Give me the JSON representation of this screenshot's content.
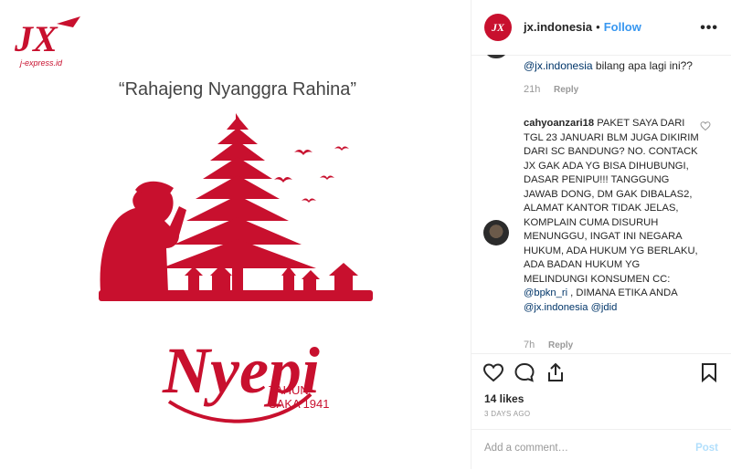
{
  "image": {
    "logo_text": "JX",
    "logo_tagline": "j-express.id",
    "greeting": "“Rahajeng Nyanggra Rahina”",
    "title": "Nyepi",
    "tahun": "TAHUN",
    "saka": "SAKA 1941",
    "brand_color": "#c8102e"
  },
  "header": {
    "avatar_text": "JX",
    "username": "jx.indonesia",
    "dot": "•",
    "follow": "Follow",
    "more": "•••"
  },
  "comments": [
    {
      "mention": "@jx.indonesia",
      "text": " bilang apa lagi ini??",
      "time": "21h",
      "reply": "Reply"
    },
    {
      "username": "cahyoanzari18",
      "text_before": " PAKET SAYA DARI TGL 23 JANUARI BLM JUGA DIKIRIM DARI SC BANDUNG? NO. CONTACK JX GAK ADA YG BISA DIHUBUNGI, DASAR PENIPU!!! TANGGUNG JAWAB DONG, DM GAK DIBALAS2, ALAMAT KANTOR TIDAK JELAS, KOMPLAIN CUMA DISURUH MENUNGGU, INGAT INI NEGARA HUKUM, ADA HUKUM YG BERLAKU, ADA BADAN HUKUM YG MELINDUNGI KONSUMEN CC: ",
      "mention1": "@bpkn_ri",
      "text_mid": " , DIMANA ETIKA ANDA ",
      "mention2": "@jx.indonesia",
      "mention3": "@jdid",
      "time": "7h",
      "reply": "Reply"
    }
  ],
  "actions": {
    "likes": "14 likes",
    "date": "3 DAYS AGO",
    "add_comment_placeholder": "Add a comment…",
    "post": "Post"
  }
}
